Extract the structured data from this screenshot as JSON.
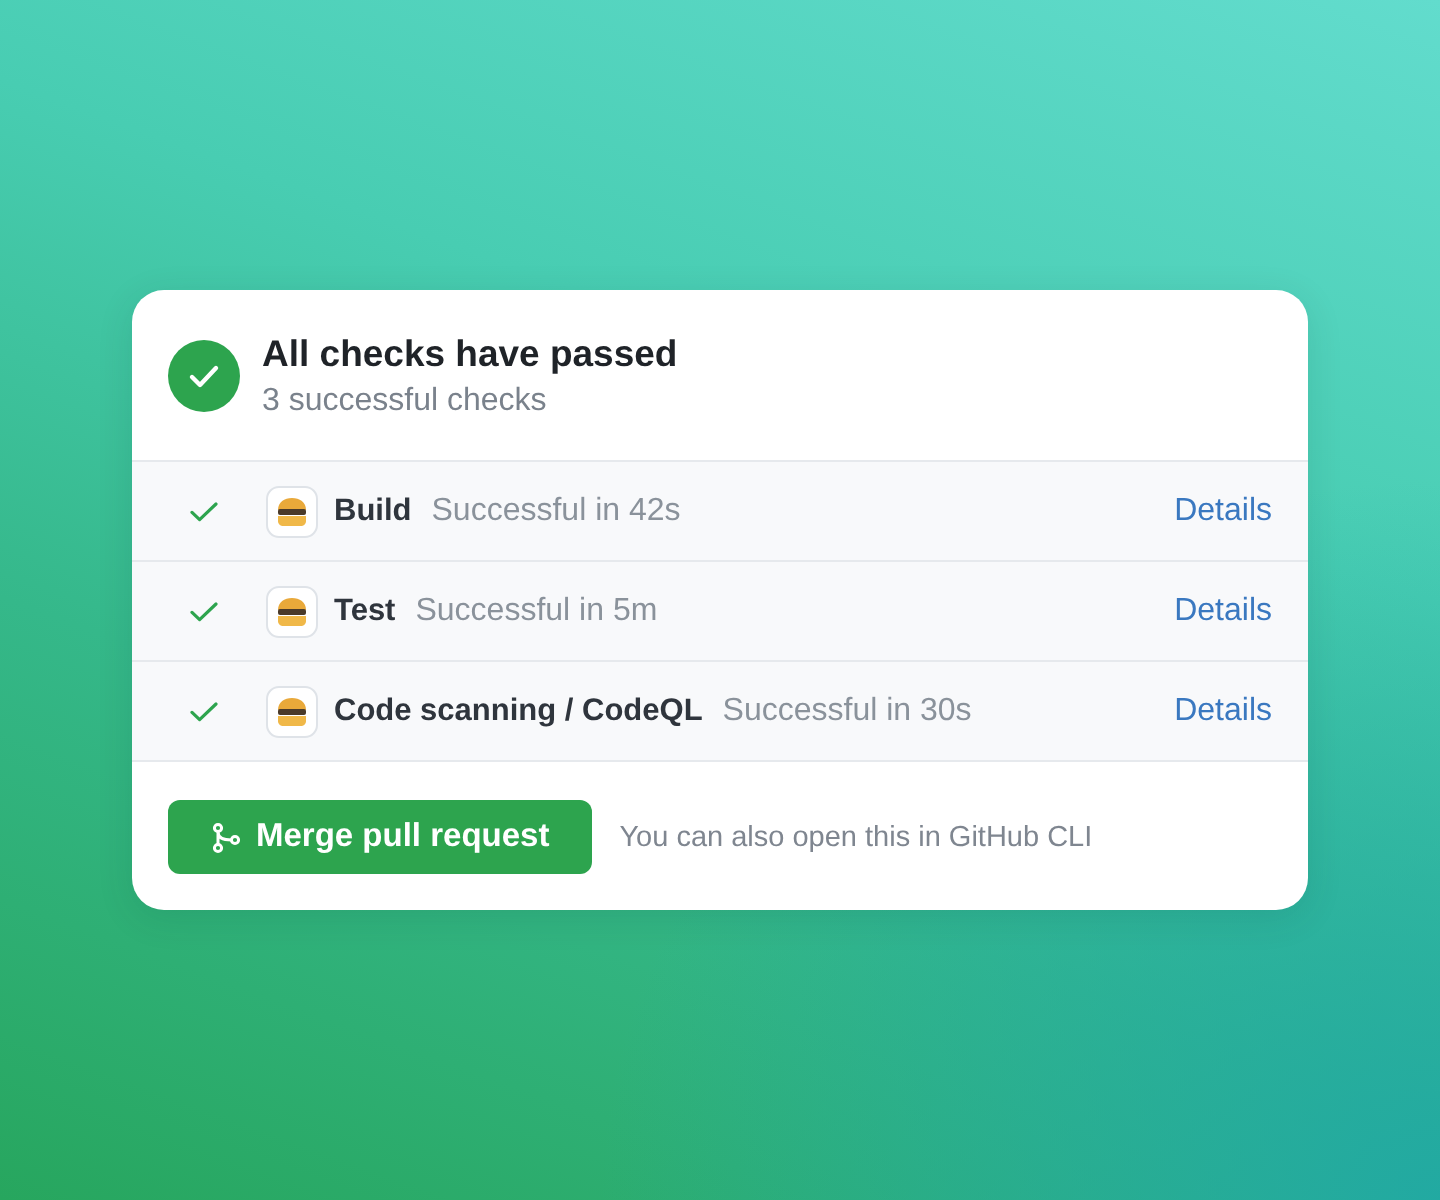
{
  "header": {
    "passed": true,
    "title": "All checks have passed",
    "subtitle": "3 successful checks"
  },
  "checks": [
    {
      "passed": true,
      "name": "Build",
      "result": "Successful in 42s",
      "link": "Details"
    },
    {
      "passed": true,
      "name": "Test",
      "result": "Successful in 5m",
      "link": "Details"
    },
    {
      "passed": true,
      "name": "Code scanning / CodeQL",
      "result": "Successful in 30s",
      "link": "Details"
    }
  ],
  "footer": {
    "button": "Merge pull request",
    "note": "You can also open this in GitHub CLI"
  }
}
